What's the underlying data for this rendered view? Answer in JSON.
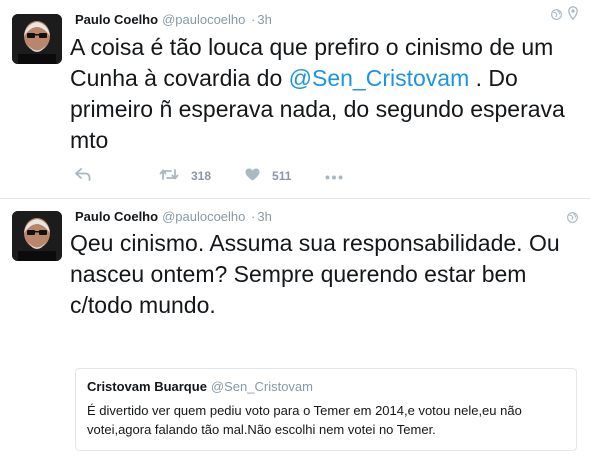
{
  "tweets": [
    {
      "author_name": "Paulo Coelho",
      "handle": "@paulocoelho",
      "separator": "·",
      "time": "3h",
      "text_before": "A coisa é tão louca que prefiro o cinismo de um Cunha à covardia do ",
      "mention": "@Sen_Cristovam",
      "text_after": " . Do primeiro ñ esperava nada, do segundo esperava mto",
      "icons": [
        "globe-icon",
        "location-pin-icon"
      ],
      "actions": {
        "reply_icon": "reply-icon",
        "retweet_icon": "retweet-icon",
        "retweet_count": "318",
        "like_icon": "heart-icon",
        "like_count": "511",
        "more_icon": "more-dots-icon"
      }
    },
    {
      "author_name": "Paulo Coelho",
      "handle": "@paulocoelho",
      "separator": "·",
      "time": "3h",
      "text": "Qeu cinismo. Assuma sua responsabilidade. Ou nasceu ontem? Sempre querendo estar bem c/todo mundo.",
      "icons": [
        "globe-icon"
      ],
      "quote": {
        "author_name": "Cristovam Buarque",
        "handle": "@Sen_Cristovam",
        "text": "É divertido ver quem pediu voto para o Temer em 2014,e votou nele,eu não votei,agora falando tão mal.Não escolhi nem votei no Temer."
      }
    }
  ],
  "colors": {
    "mention": "#1b95e0",
    "secondary_text": "#8899a6",
    "border": "#e1e8ed"
  }
}
